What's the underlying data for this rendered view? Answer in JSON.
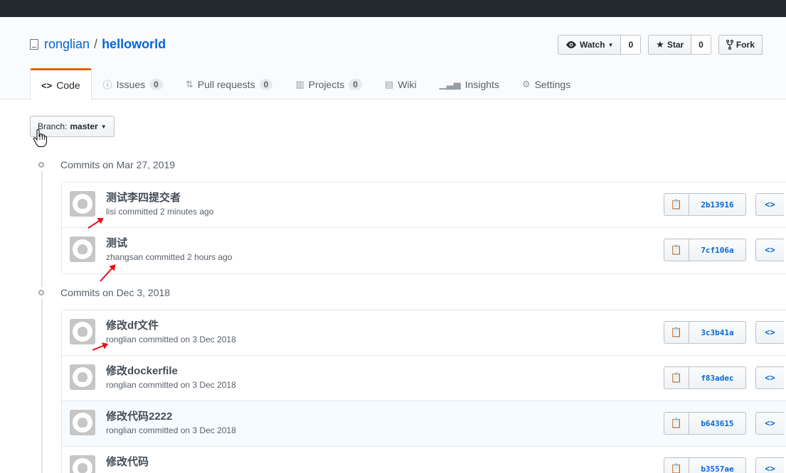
{
  "repo": {
    "owner": "ronglian",
    "sep": "/",
    "name": "helloworld"
  },
  "actions": {
    "watch_label": "Watch",
    "watch_count": "0",
    "star_label": "Star",
    "star_count": "0",
    "fork_label": "Fork"
  },
  "tabs": [
    {
      "label": "Code",
      "icon": "code-icon",
      "counter": ""
    },
    {
      "label": "Issues",
      "icon": "issue-icon",
      "counter": "0"
    },
    {
      "label": "Pull requests",
      "icon": "pull-request-icon",
      "counter": "0"
    },
    {
      "label": "Projects",
      "icon": "project-icon",
      "counter": "0"
    },
    {
      "label": "Wiki",
      "icon": "book-icon",
      "counter": ""
    },
    {
      "label": "Insights",
      "icon": "graph-icon",
      "counter": ""
    },
    {
      "label": "Settings",
      "icon": "gear-icon",
      "counter": ""
    }
  ],
  "branch": {
    "prefix": "Branch:",
    "name": "master"
  },
  "groups": [
    {
      "heading": "Commits on Mar 27, 2019",
      "commits": [
        {
          "title": "测试李四提交者",
          "meta": "lisi committed 2 minutes ago",
          "sha": "2b13916"
        },
        {
          "title": "测试",
          "meta": "zhangsan committed 2 hours ago",
          "sha": "7cf106a"
        }
      ]
    },
    {
      "heading": "Commits on Dec 3, 2018",
      "commits": [
        {
          "title": "修改df文件",
          "meta": "ronglian committed on 3 Dec 2018",
          "sha": "3c3b41a"
        },
        {
          "title": "修改dockerfile",
          "meta": "ronglian committed on 3 Dec 2018",
          "sha": "f83adec"
        },
        {
          "title": "修改代码2222",
          "meta": "ronglian committed on 3 Dec 2018",
          "sha": "b643615"
        },
        {
          "title": "修改代码",
          "meta": "",
          "sha": "b3557ae"
        }
      ]
    }
  ],
  "colors": {
    "accent": "#0366d6",
    "tab_underline": "#e36209",
    "annotation_arrow": "#e8101a"
  }
}
